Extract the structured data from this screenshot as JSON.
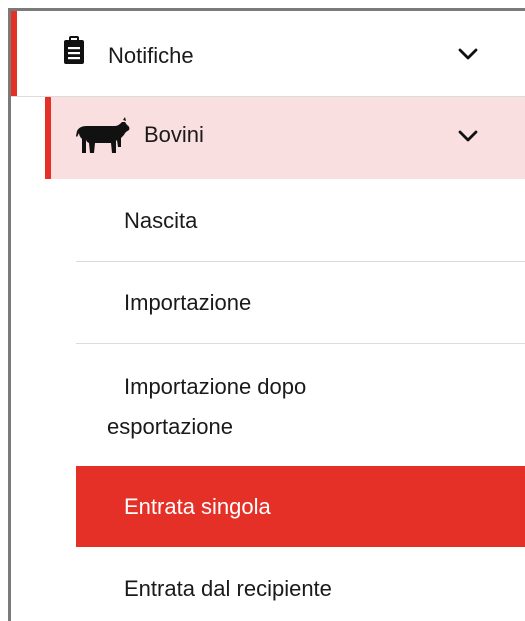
{
  "menu": {
    "notifiche": {
      "label": "Notifiche",
      "icon": "clipboard-icon",
      "expanded": true
    },
    "bovini": {
      "label": "Bovini",
      "icon": "cow-icon",
      "expanded": true
    },
    "items": [
      {
        "label": "Nascita",
        "active": false
      },
      {
        "label": "Importazione",
        "active": false
      },
      {
        "label_line1": "Importazione dopo",
        "label_line2": "esportazione",
        "active": false
      },
      {
        "label": "Entrata singola",
        "active": true
      },
      {
        "label": "Entrata dal recipiente",
        "active": false
      }
    ]
  },
  "colors": {
    "accent_red": "#e53027",
    "level2_background": "#f9dfdf",
    "separator": "#dcdcdc",
    "text": "#1a1a1a"
  }
}
